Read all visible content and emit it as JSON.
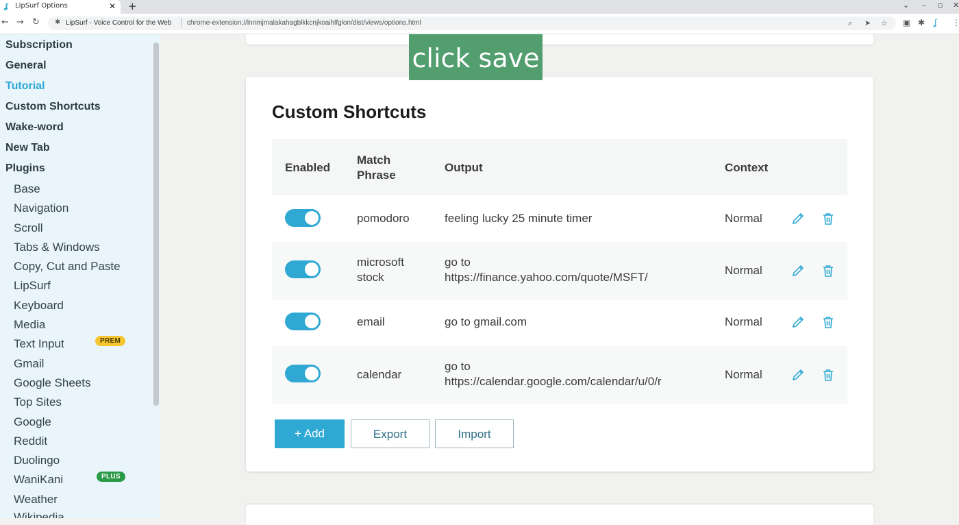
{
  "browser": {
    "tab_title": "LipSurf Options",
    "tab_close": "✕",
    "new_tab": "+",
    "site_name": "LipSurf - Voice Control for the Web",
    "url": "chrome-extension://lnnmjmalakahagblkkcnjkoaihlfglon/dist/views/options.html"
  },
  "overlay_text": "click save",
  "sidebar": {
    "items": [
      {
        "label": "Subscription"
      },
      {
        "label": "General"
      },
      {
        "label": "Tutorial"
      },
      {
        "label": "Custom Shortcuts"
      },
      {
        "label": "Wake-word"
      },
      {
        "label": "New Tab"
      },
      {
        "label": "Plugins"
      }
    ],
    "plugins": [
      {
        "label": "Base"
      },
      {
        "label": "Navigation"
      },
      {
        "label": "Scroll"
      },
      {
        "label": "Tabs & Windows"
      },
      {
        "label": "Copy, Cut and Paste"
      },
      {
        "label": "LipSurf"
      },
      {
        "label": "Keyboard"
      },
      {
        "label": "Media"
      },
      {
        "label": "Text Input",
        "badge": "PREM"
      },
      {
        "label": "Gmail"
      },
      {
        "label": "Google Sheets"
      },
      {
        "label": "Top Sites"
      },
      {
        "label": "Google"
      },
      {
        "label": "Reddit"
      },
      {
        "label": "Duolingo"
      },
      {
        "label": "WaniKani",
        "badge": "PLUS"
      },
      {
        "label": "Weather"
      },
      {
        "label": "Wikipedia"
      }
    ]
  },
  "main": {
    "title": "Custom Shortcuts",
    "columns": {
      "enabled": "Enabled",
      "match_1": "Match",
      "match_2": "Phrase",
      "output": "Output",
      "context": "Context"
    },
    "rows": [
      {
        "enabled": true,
        "phrase_1": "pomodoro",
        "phrase_2": "",
        "output_1": "feeling lucky 25 minute timer",
        "output_2": "",
        "context": "Normal"
      },
      {
        "enabled": true,
        "phrase_1": "microsoft",
        "phrase_2": "stock",
        "output_1": "go to",
        "output_2": "https://finance.yahoo.com/quote/MSFT/",
        "context": "Normal"
      },
      {
        "enabled": true,
        "phrase_1": "email",
        "phrase_2": "",
        "output_1": "go to gmail.com",
        "output_2": "",
        "context": "Normal"
      },
      {
        "enabled": true,
        "phrase_1": "calendar",
        "phrase_2": "",
        "output_1": "go to",
        "output_2": "https://calendar.google.com/calendar/u/0/r",
        "context": "Normal"
      }
    ],
    "buttons": {
      "add": "+ Add",
      "export": "Export",
      "import": "Import"
    }
  },
  "colors": {
    "accent": "#2fa9d4",
    "overlay": "#529e6e",
    "sidebar_bg": "#e9f4fb",
    "prem": "#f6c631",
    "plus": "#2a9a46"
  }
}
